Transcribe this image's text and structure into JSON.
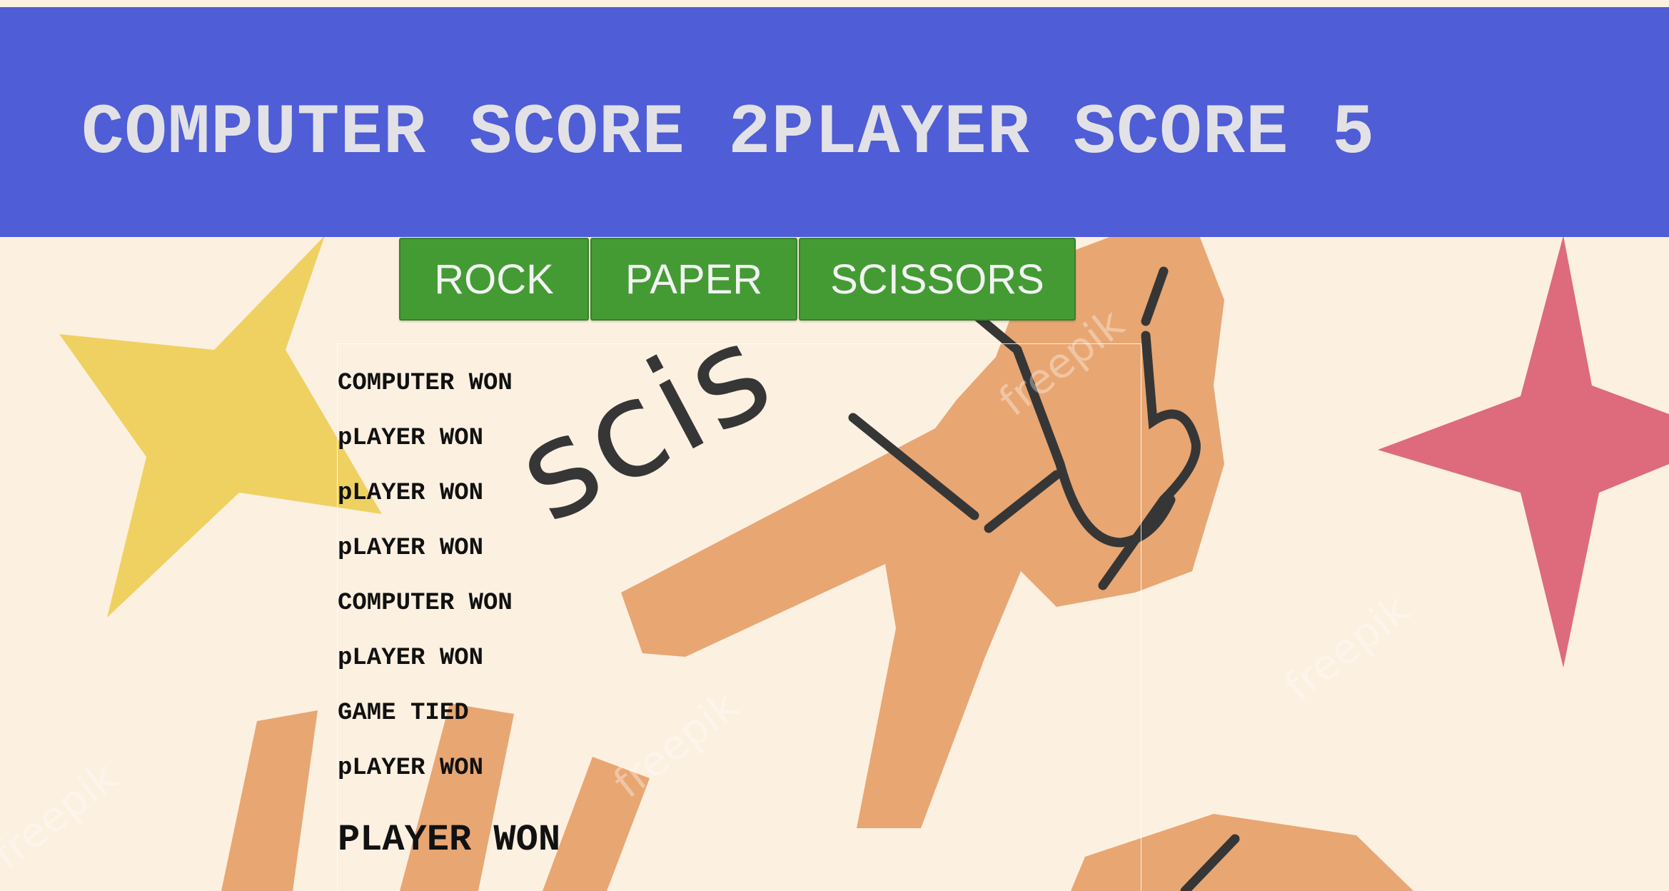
{
  "scoreboard": {
    "computer_label": "COMPUTER SCORE ",
    "computer_score": "2",
    "player_label": "PLAYER SCORE ",
    "player_score": "5"
  },
  "choices": {
    "rock": "ROCK",
    "paper": "PAPER",
    "scissors": "SCISSORS"
  },
  "history": [
    "COMPUTER WON",
    "pLAYER WON",
    "pLAYER WON",
    "pLAYER WON",
    "COMPUTER WON",
    "pLAYER WON",
    "GAME TIED",
    "pLAYER WON"
  ],
  "final_result": "PLAYER WON",
  "background": {
    "word": "scissors",
    "watermark": "freepik"
  },
  "colors": {
    "header": "#4f5dd6",
    "button": "#449b34",
    "page_background": "#fcf0e1",
    "hand": "#e8a672",
    "star_yellow": "#efd162",
    "star_pink": "#dd6b7b"
  }
}
